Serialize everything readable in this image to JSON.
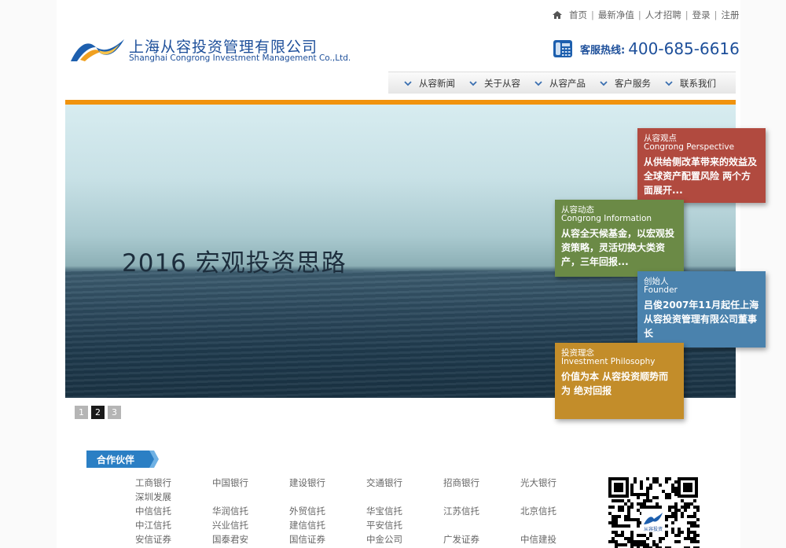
{
  "top_links": {
    "home": "首页",
    "nav": "最新净值",
    "jobs": "人才招聘",
    "login": "登录",
    "register": "注册"
  },
  "logo": {
    "cn": "上海从容投资管理有限公司",
    "en": "Shanghai Congrong Investment Management Co.,Ltd."
  },
  "hotline": {
    "label": "客服热线:",
    "number": "400-685-6616"
  },
  "nav": [
    "从容新闻",
    "关于从容",
    "从容产品",
    "客户服务",
    "联系我们"
  ],
  "banner": {
    "title": "2016 宏观投资思路",
    "pages": [
      "1",
      "2",
      "3"
    ],
    "active_page": "2"
  },
  "tiles": [
    {
      "cn": "从容观点",
      "en": "Congrong Perspective",
      "body": "从供给侧改革带来的效益及 全球资产配置风险 两个方面展开..."
    },
    {
      "cn": "从容动态",
      "en": "Congrong Information",
      "body": "从容全天候基金，以宏观投资策略，灵活切换大类资产，三年回报..."
    },
    {
      "cn": "创始人",
      "en": "Founder",
      "body": "吕俊2007年11月起任上海从容投资管理有限公司董事长"
    },
    {
      "cn": "投资理念",
      "en": "Investment Philosophy",
      "body": "价值为本 从容投资顺势而为 绝对回报"
    }
  ],
  "partners": {
    "title": "合作伙伴",
    "items": [
      "工商银行",
      "中国银行",
      "建设银行",
      "交通银行",
      "招商银行",
      "光大银行",
      "深圳发展",
      "",
      "",
      "",
      "",
      "",
      "中信信托",
      "华润信托",
      "外贸信托",
      "华宝信托",
      "江苏信托",
      "北京信托",
      "中江信托",
      "兴业信托",
      "建信信托",
      "平安信托",
      "",
      "",
      "安信证券",
      "国泰君安",
      "国信证券",
      "中金公司",
      "广发证券",
      "中信建投"
    ]
  },
  "qr": {
    "caption": "从容投资"
  },
  "colors": {
    "brand_blue": "#1d4f9a",
    "accent_orange": "#f0930e",
    "tile_red": "#b14a3f",
    "tile_green": "#6b8a46",
    "tile_blue": "#4a82ad",
    "tile_gold": "#c38d2a"
  }
}
